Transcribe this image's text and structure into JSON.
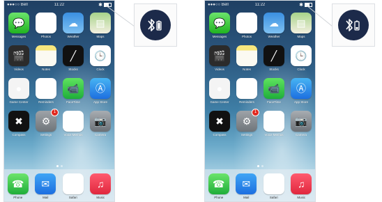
{
  "left_phone": {
    "status": {
      "carrier": "●●●○○ Bell",
      "time": "11:22",
      "bt_glyph": "✱"
    },
    "apps": [
      {
        "label": "Messages",
        "cls": "t-messages",
        "glyph": "💬",
        "icon": "messages-icon"
      },
      {
        "label": "Photos",
        "cls": "t-photos",
        "glyph": "❀",
        "icon": "photos-icon"
      },
      {
        "label": "Weather",
        "cls": "t-weather",
        "glyph": "☁",
        "icon": "weather-icon"
      },
      {
        "label": "Maps",
        "cls": "t-maps",
        "glyph": "▤",
        "icon": "maps-icon"
      },
      {
        "label": "Videos",
        "cls": "t-videos",
        "glyph": "🎬",
        "icon": "videos-icon"
      },
      {
        "label": "Notes",
        "cls": "t-notes",
        "glyph": "",
        "icon": "notes-icon"
      },
      {
        "label": "Stocks",
        "cls": "t-stocks",
        "glyph": "╱",
        "icon": "stocks-icon"
      },
      {
        "label": "Clock",
        "cls": "t-clock",
        "glyph": "🕒",
        "icon": "clock-icon"
      },
      {
        "label": "Game Center",
        "cls": "t-gamecenter",
        "glyph": "●",
        "icon": "game-center-icon"
      },
      {
        "label": "Reminders",
        "cls": "t-reminders",
        "glyph": "☰",
        "icon": "reminders-icon"
      },
      {
        "label": "FaceTime",
        "cls": "t-facetime",
        "glyph": "📹",
        "icon": "facetime-icon"
      },
      {
        "label": "App Store",
        "cls": "t-appstore",
        "glyph": "Ⓐ",
        "icon": "app-store-icon"
      },
      {
        "label": "Compass",
        "cls": "t-compass",
        "glyph": "✖",
        "icon": "compass-icon"
      },
      {
        "label": "Settings",
        "cls": "t-settings",
        "glyph": "⚙",
        "icon": "settings-icon",
        "badge": "1"
      },
      {
        "label": "Voice Memos",
        "cls": "t-voicememos",
        "glyph": "⌇",
        "icon": "voice-memos-icon"
      },
      {
        "label": "Camera",
        "cls": "t-camera",
        "glyph": "📷",
        "icon": "camera-icon"
      }
    ],
    "dock": [
      {
        "label": "Phone",
        "cls": "t-phone",
        "glyph": "☎",
        "icon": "phone-icon"
      },
      {
        "label": "Mail",
        "cls": "t-mail",
        "glyph": "✉",
        "icon": "mail-icon"
      },
      {
        "label": "Safari",
        "cls": "t-safari",
        "glyph": "✲",
        "icon": "safari-icon"
      },
      {
        "label": "Music",
        "cls": "t-music",
        "glyph": "♫",
        "icon": "music-icon"
      }
    ]
  },
  "right_phone": {
    "status": {
      "carrier": "●●●○○ Bell",
      "time": "11:22",
      "bt_glyph": "✱"
    },
    "apps": [
      {
        "label": "Messages",
        "cls": "t-messages",
        "glyph": "💬",
        "icon": "messages-icon"
      },
      {
        "label": "Photos",
        "cls": "t-photos",
        "glyph": "❀",
        "icon": "photos-icon"
      },
      {
        "label": "Weather",
        "cls": "t-weather",
        "glyph": "☁",
        "icon": "weather-icon"
      },
      {
        "label": "Maps",
        "cls": "t-maps",
        "glyph": "▤",
        "icon": "maps-icon"
      },
      {
        "label": "Videos",
        "cls": "t-videos",
        "glyph": "🎬",
        "icon": "videos-icon"
      },
      {
        "label": "Notes",
        "cls": "t-notes",
        "glyph": "",
        "icon": "notes-icon"
      },
      {
        "label": "Stocks",
        "cls": "t-stocks",
        "glyph": "╱",
        "icon": "stocks-icon"
      },
      {
        "label": "Clock",
        "cls": "t-clock",
        "glyph": "🕒",
        "icon": "clock-icon"
      },
      {
        "label": "Game Center",
        "cls": "t-gamecenter",
        "glyph": "●",
        "icon": "game-center-icon"
      },
      {
        "label": "Reminders",
        "cls": "t-reminders",
        "glyph": "☰",
        "icon": "reminders-icon"
      },
      {
        "label": "FaceTime",
        "cls": "t-facetime",
        "glyph": "📹",
        "icon": "facetime-icon"
      },
      {
        "label": "App Store",
        "cls": "t-appstore",
        "glyph": "Ⓐ",
        "icon": "app-store-icon"
      },
      {
        "label": "Compass",
        "cls": "t-compass",
        "glyph": "✖",
        "icon": "compass-icon"
      },
      {
        "label": "Settings",
        "cls": "t-settings",
        "glyph": "⚙",
        "icon": "settings-icon",
        "badge": "1"
      },
      {
        "label": "Voice Memos",
        "cls": "t-voicememos",
        "glyph": "⌇",
        "icon": "voice-memos-icon"
      },
      {
        "label": "Camera",
        "cls": "t-camera",
        "glyph": "📷",
        "icon": "camera-icon"
      }
    ],
    "dock": [
      {
        "label": "Phone",
        "cls": "t-phone",
        "glyph": "☎",
        "icon": "phone-icon"
      },
      {
        "label": "Mail",
        "cls": "t-mail",
        "glyph": "✉",
        "icon": "mail-icon"
      },
      {
        "label": "Safari",
        "cls": "t-safari",
        "glyph": "✲",
        "icon": "safari-icon"
      },
      {
        "label": "Music",
        "cls": "t-music",
        "glyph": "♫",
        "icon": "music-icon"
      }
    ]
  },
  "callouts": {
    "left": {
      "icon": "bluetooth-battery-icon",
      "variant": "battery-high"
    },
    "right": {
      "icon": "bluetooth-battery-icon",
      "variant": "battery-low"
    }
  },
  "colors": {
    "callout_circle": "#1c2a4a",
    "badge": "#e0281f"
  }
}
